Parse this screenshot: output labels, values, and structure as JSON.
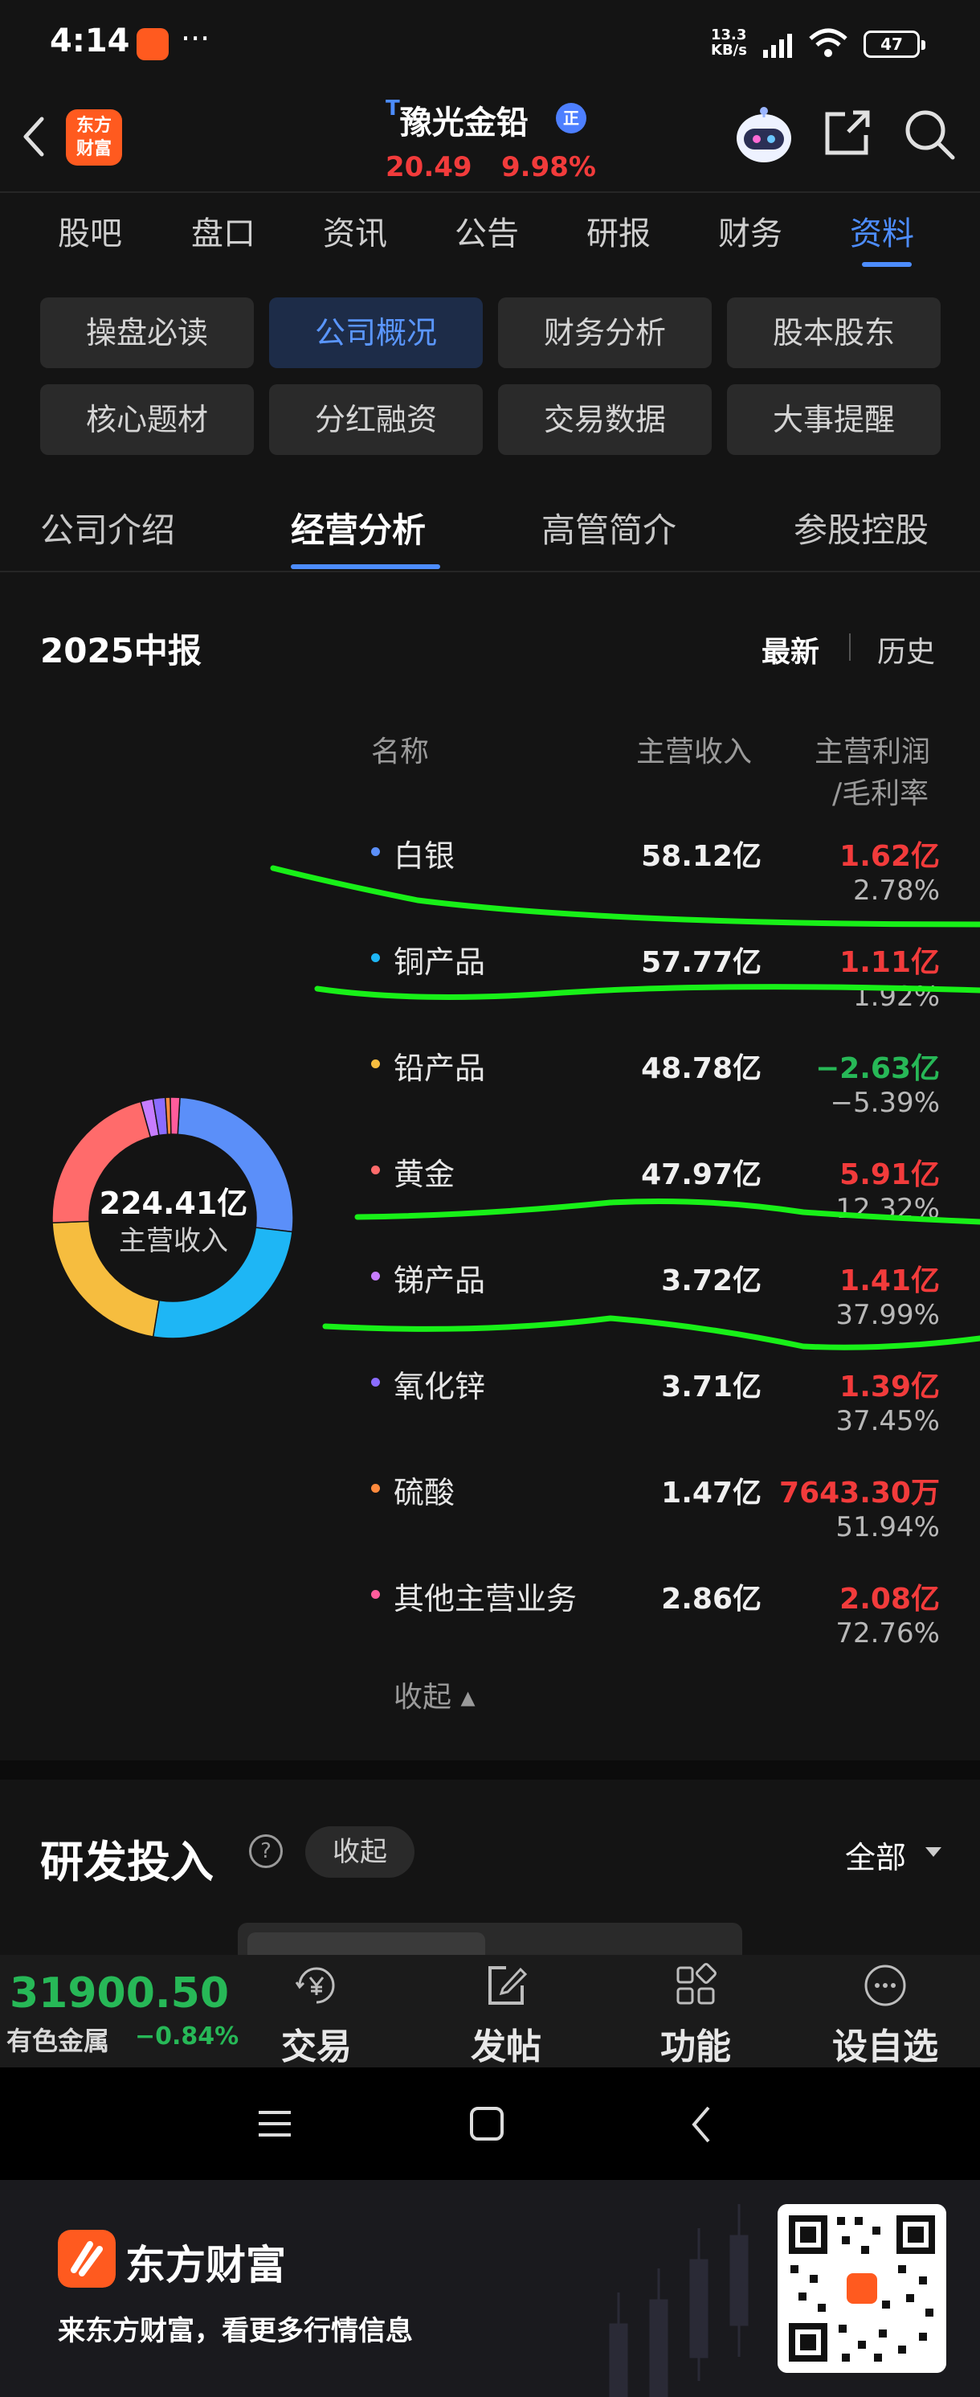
{
  "status": {
    "time": "4:14",
    "dots": "···",
    "net_speed": "13.3",
    "net_unit": "KB/s",
    "battery": "47"
  },
  "header": {
    "logo_text": "东方\n财富",
    "t_mark": "T",
    "stock_name": "豫光金铅",
    "badge": "正",
    "price": "20.49",
    "change_pct": "9.98%"
  },
  "top_tabs": [
    "股吧",
    "盘口",
    "资讯",
    "公告",
    "研报",
    "财务",
    "资料"
  ],
  "top_tab_active": 6,
  "grid": [
    "操盘必读",
    "公司概况",
    "财务分析",
    "股本股东",
    "核心题材",
    "分红融资",
    "交易数据",
    "大事提醒"
  ],
  "sub_tabs": [
    "公司介绍",
    "经营分析",
    "高管简介",
    "参股控股"
  ],
  "section": {
    "title": "2025中报",
    "latest": "最新",
    "history": "历史",
    "col_name": "名称",
    "col_revenue": "主营收入",
    "col_profit": "主营利润",
    "col_margin": "/毛利率",
    "total_value": "224.41亿",
    "total_label": "主营收入",
    "collapse": "收起 ▴"
  },
  "rows": [
    {
      "name": "白银",
      "revenue": "58.12亿",
      "profit": "1.62亿",
      "margin": "2.78%",
      "color": "#5b8ff9",
      "profit_color": "red"
    },
    {
      "name": "铜产品",
      "revenue": "57.77亿",
      "profit": "1.11亿",
      "margin": "1.92%",
      "color": "#1eb6f5",
      "profit_color": "red"
    },
    {
      "name": "铅产品",
      "revenue": "48.78亿",
      "profit": "−2.63亿",
      "margin": "−5.39%",
      "color": "#f6bd3f",
      "profit_color": "green"
    },
    {
      "name": "黄金",
      "revenue": "47.97亿",
      "profit": "5.91亿",
      "margin": "12.32%",
      "color": "#ff6b6b",
      "profit_color": "red"
    },
    {
      "name": "锑产品",
      "revenue": "3.72亿",
      "profit": "1.41亿",
      "margin": "37.99%",
      "color": "#c77dff",
      "profit_color": "red"
    },
    {
      "name": "氧化锌",
      "revenue": "3.71亿",
      "profit": "1.39亿",
      "margin": "37.45%",
      "color": "#8a6cff",
      "profit_color": "red"
    },
    {
      "name": "硫酸",
      "revenue": "1.47亿",
      "profit": "7643.30万",
      "margin": "51.94%",
      "color": "#ff8a3d",
      "profit_color": "red"
    },
    {
      "name": "其他主营业务",
      "revenue": "2.86亿",
      "profit": "2.08亿",
      "margin": "72.76%",
      "color": "#ff5c9b",
      "profit_color": "red"
    }
  ],
  "chart_data": {
    "type": "pie",
    "categories": [
      "白银",
      "铜产品",
      "铅产品",
      "黄金",
      "锑产品",
      "氧化锌",
      "硫酸",
      "其他主营业务"
    ],
    "values": [
      58.12,
      57.77,
      48.78,
      47.97,
      3.72,
      3.71,
      1.47,
      2.86
    ],
    "colors": [
      "#5b8ff9",
      "#1eb6f5",
      "#f6bd3f",
      "#ff6b6b",
      "#c77dff",
      "#8a6cff",
      "#ff8a3d",
      "#ff5c9b"
    ],
    "title": "",
    "center_label": "224.41亿"
  },
  "rd": {
    "title": "研发投入",
    "help": "?",
    "collapse": "收起",
    "all": "全部"
  },
  "bottom": {
    "index_value": "31900.50",
    "index_name": "有色金属",
    "index_change": "−0.84%",
    "nav": [
      {
        "label": "交易",
        "icon": "yen-circle-icon"
      },
      {
        "label": "发帖",
        "icon": "edit-icon"
      },
      {
        "label": "功能",
        "icon": "grid-icon"
      },
      {
        "label": "设自选",
        "icon": "more-circle-icon"
      }
    ]
  },
  "promo": {
    "brand": "东方财富",
    "slogan": "来东方财富，看更多行情信息"
  }
}
